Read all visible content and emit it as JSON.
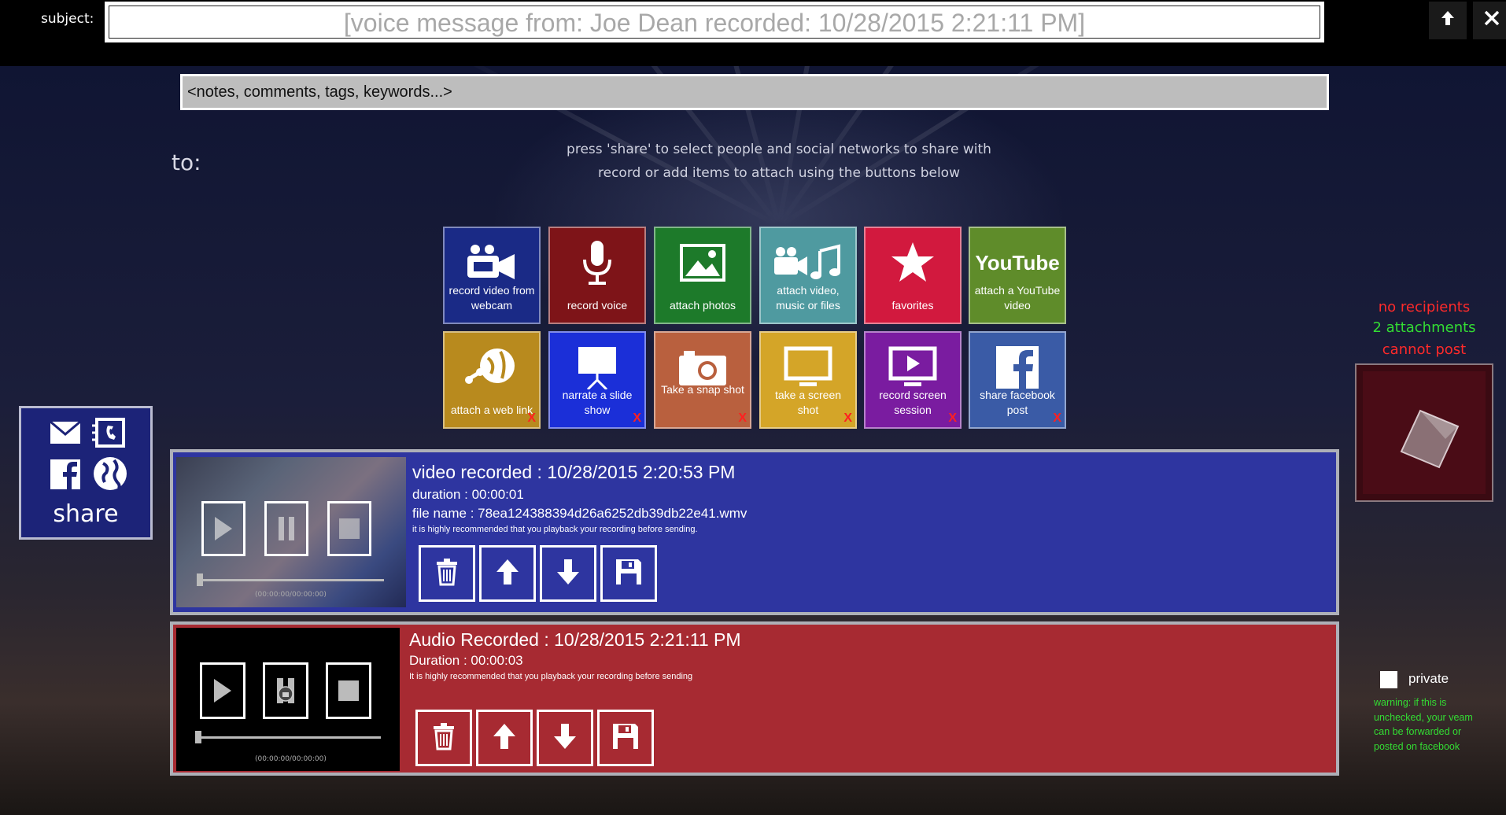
{
  "header": {
    "subject_label": "subject:",
    "subject_value": "[voice message from: Joe Dean recorded: 10/28/2015 2:21:11 PM]",
    "up_icon": "arrow-up-icon",
    "close_icon": "close-icon"
  },
  "notes": {
    "placeholder": "<notes, comments, tags, keywords...>"
  },
  "to_label": "to:",
  "hints": {
    "line1": "press 'share' to select people and social networks to share with",
    "line2": "record or add items to attach using the buttons below"
  },
  "tiles": [
    {
      "label": "record video from webcam",
      "icon": "video-camera-icon",
      "color": "#1a2a86"
    },
    {
      "label": "record voice",
      "icon": "microphone-icon",
      "color": "#7e1418"
    },
    {
      "label": "attach photos",
      "icon": "photo-icon",
      "color": "#1d7a2a"
    },
    {
      "label": "attach video, music or files",
      "icon": "media-files-icon",
      "color": "#4f9aa0"
    },
    {
      "label": "favorites",
      "icon": "star-icon",
      "color": "#d2193e"
    },
    {
      "label": "attach a YouTube video",
      "icon": "youtube-icon",
      "color": "#5f8c2a",
      "brand": "YouTube"
    },
    {
      "label": "attach a web link",
      "icon": "web-link-icon",
      "color": "#b88a1e",
      "x": "X"
    },
    {
      "label": "narrate a slide show",
      "icon": "slideshow-icon",
      "color": "#1b2fd8",
      "x": "X"
    },
    {
      "label": "Take a snap shot",
      "icon": "camera-icon",
      "color": "#b9603e",
      "x": "X"
    },
    {
      "label": "take a screen shot",
      "icon": "monitor-icon",
      "color": "#d4a528",
      "x": "X"
    },
    {
      "label": "record screen session",
      "icon": "screen-record-icon",
      "color": "#7a1ca0",
      "x": "X"
    },
    {
      "label": "share facebook post",
      "icon": "facebook-icon",
      "color": "#3a5ba6",
      "x": "X"
    }
  ],
  "share": {
    "label": "share"
  },
  "status": {
    "recipients": "no recipients",
    "attachments": "2 attachments",
    "post": "cannot post",
    "colors": {
      "error": "#ff2a2a",
      "ok": "#33dd33"
    }
  },
  "video_item": {
    "title": "video recorded : 10/28/2015 2:20:53 PM",
    "duration": "duration : 00:00:01",
    "file_name": "file name : 78ea124388394d26a6252db39db22e41.wmv",
    "note": "it is highly recommended that you playback your recording before sending.",
    "timecode": "(00:00:00/00:00:00)",
    "color": "#2e35a0"
  },
  "audio_item": {
    "title": "Audio Recorded : 10/28/2015 2:21:11 PM",
    "duration": "Duration : 00:00:03",
    "note": "It is highly recommended that you playback your recording before sending",
    "timecode": "(00:00:00/00:00:00)",
    "color": "#a72a32"
  },
  "privacy": {
    "label": "private",
    "checked": false,
    "warning": "warning: if this is unchecked, your veam can be forwarded or posted on facebook"
  }
}
